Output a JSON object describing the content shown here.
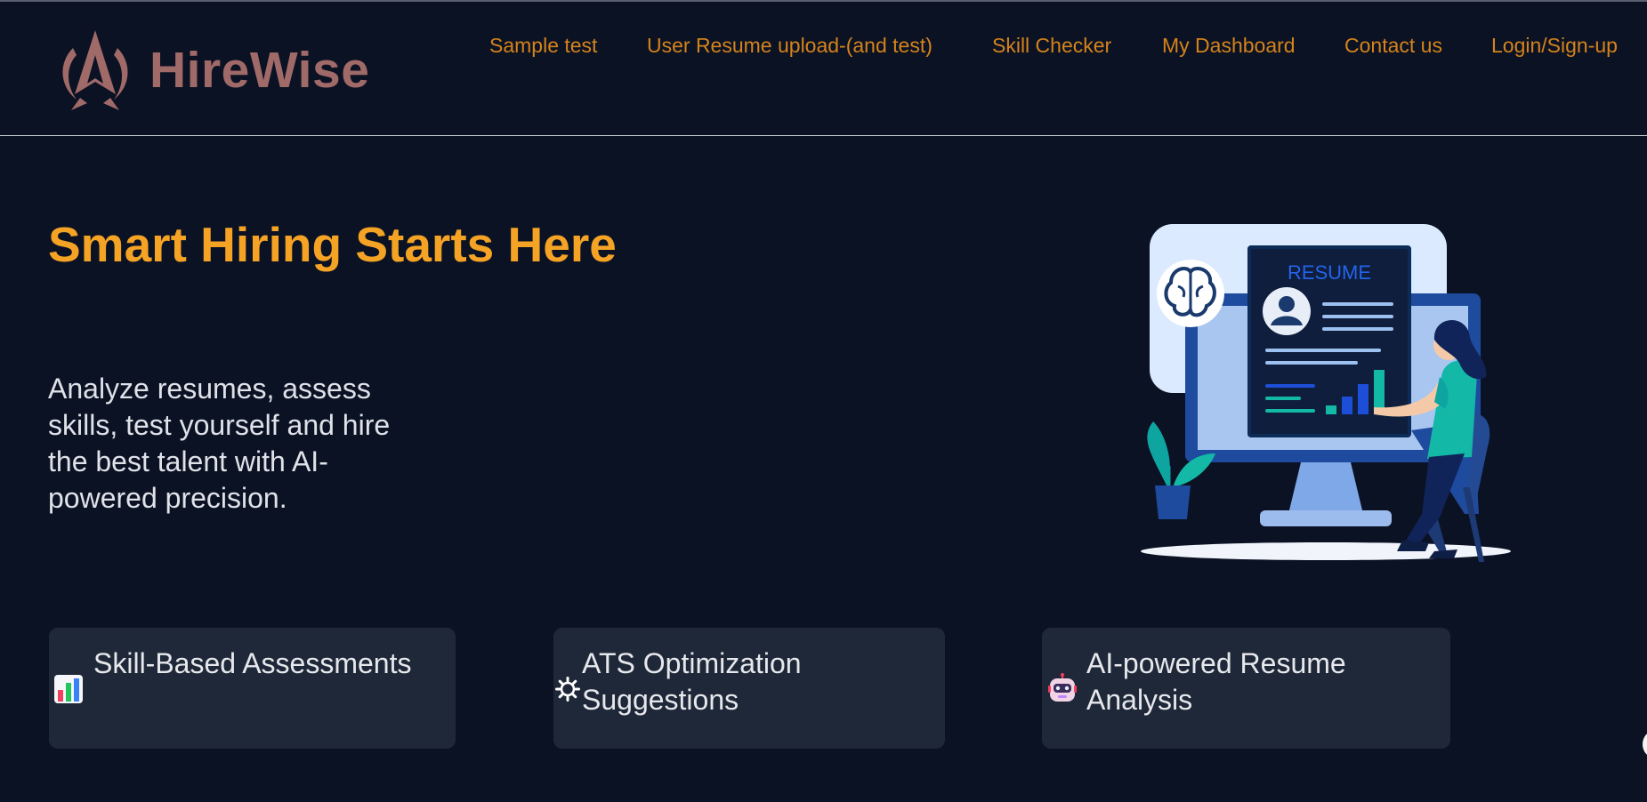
{
  "brand": {
    "name": "HireWise",
    "logo_icon": "arrow-a-logo-icon",
    "name_color": "#a06a68"
  },
  "nav": {
    "items": [
      {
        "label": "Sample test"
      },
      {
        "label": "User Resume upload-(and test)"
      },
      {
        "label": "Skill Checker"
      },
      {
        "label": "My Dashboard"
      },
      {
        "label": "Contact us"
      },
      {
        "label": "Login/Sign-up"
      }
    ],
    "color": "#d4831b"
  },
  "hero": {
    "title": "Smart Hiring Starts Here",
    "description": "Analyze resumes, assess skills, test yourself and hire the best talent with AI-powered precision.",
    "illustration": {
      "resume_label": "RESUME",
      "icons": [
        "brain-icon",
        "profile-avatar-icon",
        "bar-chart-icon",
        "plant-icon",
        "person-at-desk-icon"
      ]
    }
  },
  "features": [
    {
      "title": "Skill-Based Assessments",
      "icon": "bar-chart-emoji-icon"
    },
    {
      "title": "ATS Optimization Suggestions",
      "icon": "gear-icon"
    },
    {
      "title": "AI-powered Resume Analysis",
      "icon": "robot-icon"
    }
  ],
  "colors": {
    "background": "#0b1224",
    "title_accent": "#f5a324",
    "card_background": "#1f2838"
  }
}
